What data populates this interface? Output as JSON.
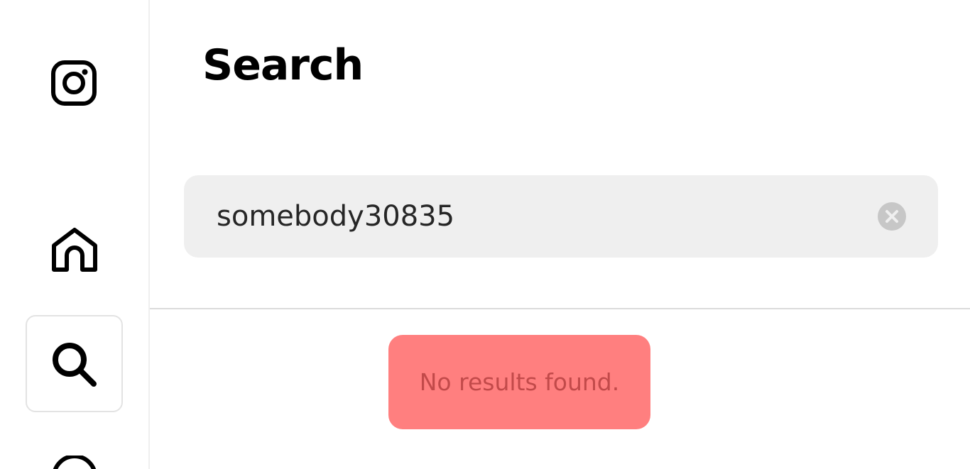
{
  "nav": {
    "logo_icon": "instagram-icon",
    "items": [
      {
        "name": "Home",
        "icon": "home-icon"
      },
      {
        "name": "Search",
        "icon": "search-icon",
        "active": true
      },
      {
        "name": "",
        "icon": "explore-icon"
      }
    ]
  },
  "search_panel": {
    "title": "Search",
    "input_value": "somebody30835",
    "clear_icon": "clear-icon",
    "empty_message": "No results found."
  },
  "colors": {
    "input_bg": "#efefef",
    "message_bg": "#ff7f7f",
    "message_text": "#c24a4a",
    "divider": "#dbdbdb"
  }
}
